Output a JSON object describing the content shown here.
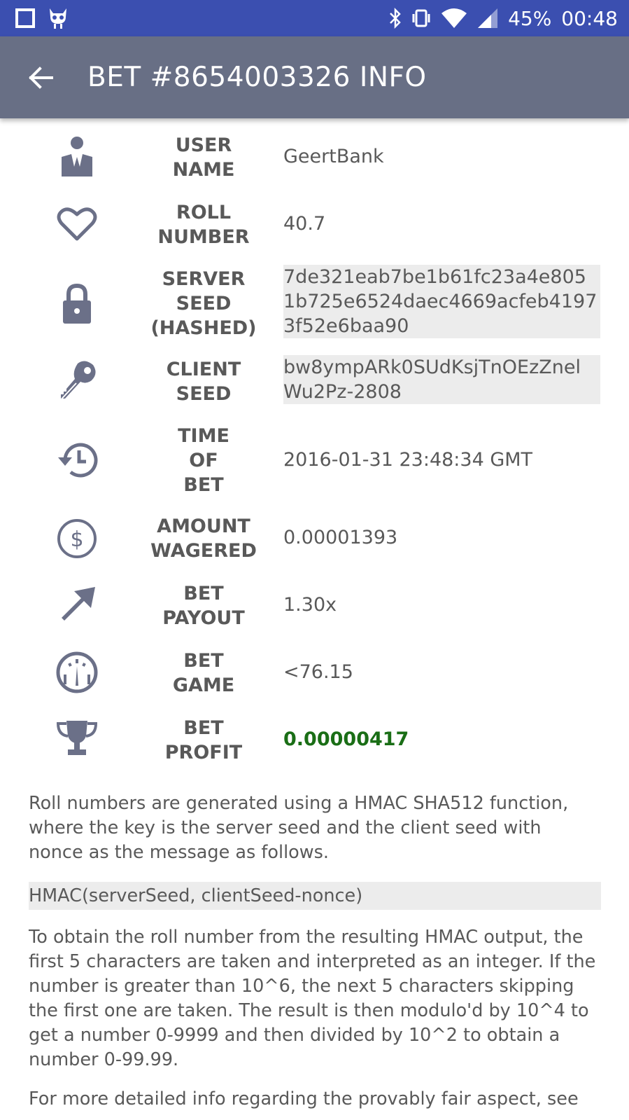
{
  "status_bar": {
    "battery": "45%",
    "time": "00:48"
  },
  "app_bar": {
    "title": "BET #8654003326 INFO"
  },
  "rows": [
    {
      "icon": "user-icon",
      "label": "USER\nNAME",
      "value": "GeertBank"
    },
    {
      "icon": "heart-icon",
      "label": "ROLL\nNUMBER",
      "value": "40.7"
    },
    {
      "icon": "lock-icon",
      "label": "SERVER\nSEED\n(HASHED)",
      "value": "7de321eab7be1b61fc23a4e8051b725e6524daec4669acfeb41973f52e6baa90"
    },
    {
      "icon": "key-icon",
      "label": "CLIENT\nSEED",
      "value": "bw8ympARk0SUdKsjTnOEzZnelWu2Pz-2808"
    },
    {
      "icon": "history-icon",
      "label": "TIME\nOF\nBET",
      "value": "2016-01-31 23:48:34 GMT"
    },
    {
      "icon": "dollar-icon",
      "label": "AMOUNT\nWAGERED",
      "value": "0.00001393"
    },
    {
      "icon": "arrow-up-right-icon",
      "label": "BET\nPAYOUT",
      "value": "1.30x"
    },
    {
      "icon": "gauge-icon",
      "label": "BET\nGAME",
      "value": "<76.15"
    },
    {
      "icon": "trophy-icon",
      "label": "BET\nPROFIT",
      "value": "0.00000417"
    }
  ],
  "colors": {
    "status_bar": "#3b4fb0",
    "app_bar": "#686f85",
    "profit": "#1a6e16",
    "code_bg": "#ececec",
    "icon": "#6b7088"
  },
  "info": {
    "paragraph1": "Roll numbers are generated using a HMAC SHA512 function, where the key is the server seed and the client seed with nonce as the message as follows.",
    "code": "HMAC(serverSeed, clientSeed-nonce)",
    "paragraph2": "To obtain the roll number from the resulting HMAC output, the first 5 characters are taken and interpreted as an integer. If the number is greater than 10^6, the next 5 characters skipping the first one are taken. The result is then modulo'd by 10^4 to get a number 0-9999 and then divided by 10^2 to obtain a number 0-99.99.",
    "paragraph3": "For more detailed info regarding the provably fair aspect, see"
  }
}
